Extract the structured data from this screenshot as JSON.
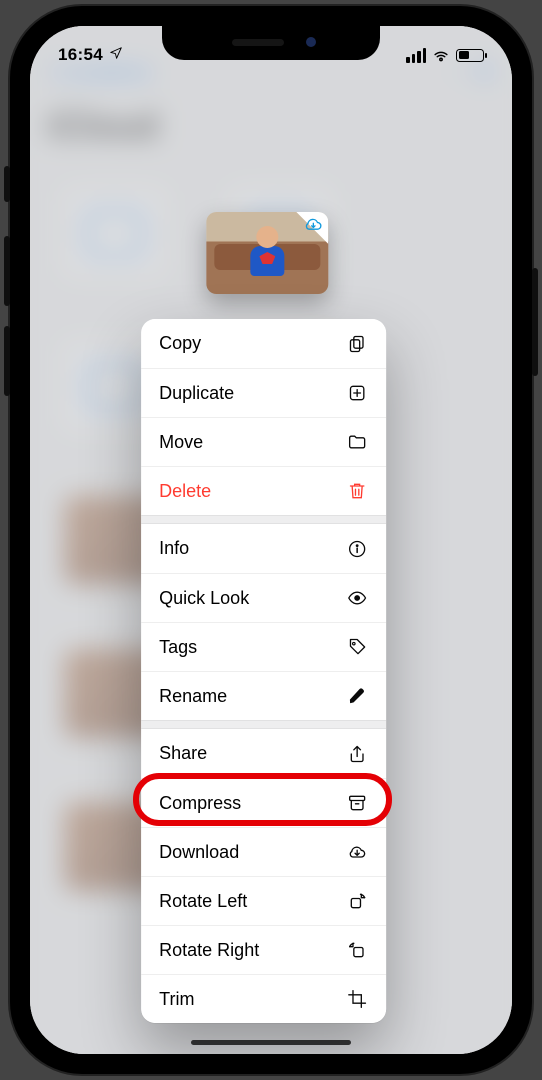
{
  "status": {
    "time": "16:54"
  },
  "menu": {
    "groups": [
      [
        {
          "id": "copy",
          "label": "Copy",
          "icon": "copy-icon",
          "destructive": false
        },
        {
          "id": "duplicate",
          "label": "Duplicate",
          "icon": "duplicate-icon",
          "destructive": false
        },
        {
          "id": "move",
          "label": "Move",
          "icon": "folder-icon",
          "destructive": false
        },
        {
          "id": "delete",
          "label": "Delete",
          "icon": "trash-icon",
          "destructive": true
        }
      ],
      [
        {
          "id": "info",
          "label": "Info",
          "icon": "info-icon",
          "destructive": false
        },
        {
          "id": "quicklook",
          "label": "Quick Look",
          "icon": "eye-icon",
          "destructive": false
        },
        {
          "id": "tags",
          "label": "Tags",
          "icon": "tag-icon",
          "destructive": false
        },
        {
          "id": "rename",
          "label": "Rename",
          "icon": "pencil-icon",
          "destructive": false
        }
      ],
      [
        {
          "id": "share",
          "label": "Share",
          "icon": "share-icon",
          "destructive": false
        },
        {
          "id": "compress",
          "label": "Compress",
          "icon": "archive-icon",
          "destructive": false
        },
        {
          "id": "download",
          "label": "Download",
          "icon": "cloud-down-icon",
          "destructive": false
        },
        {
          "id": "rotateleft",
          "label": "Rotate Left",
          "icon": "rotate-left-icon",
          "destructive": false
        },
        {
          "id": "rotateright",
          "label": "Rotate Right",
          "icon": "rotate-right-icon",
          "destructive": false
        },
        {
          "id": "trim",
          "label": "Trim",
          "icon": "crop-icon",
          "destructive": false
        }
      ]
    ]
  },
  "annotation": {
    "highlighted_item_id": "compress",
    "color": "#e40005"
  }
}
